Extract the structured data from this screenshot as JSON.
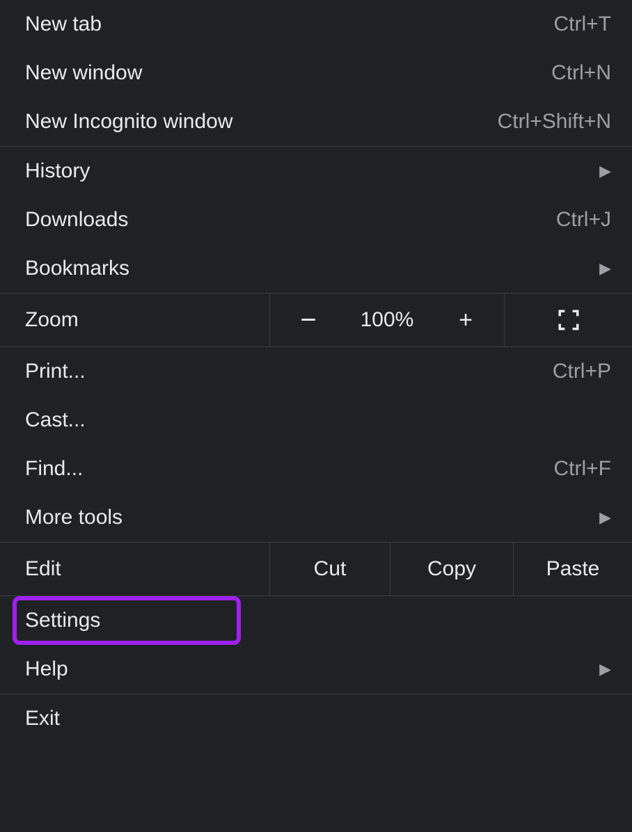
{
  "section1": {
    "new_tab": {
      "label": "New tab",
      "shortcut": "Ctrl+T"
    },
    "new_window": {
      "label": "New window",
      "shortcut": "Ctrl+N"
    },
    "new_incognito": {
      "label": "New Incognito window",
      "shortcut": "Ctrl+Shift+N"
    }
  },
  "section2": {
    "history": {
      "label": "History"
    },
    "downloads": {
      "label": "Downloads",
      "shortcut": "Ctrl+J"
    },
    "bookmarks": {
      "label": "Bookmarks"
    }
  },
  "zoom": {
    "label": "Zoom",
    "minus": "−",
    "value": "100%",
    "plus": "+"
  },
  "section3": {
    "print": {
      "label": "Print...",
      "shortcut": "Ctrl+P"
    },
    "cast": {
      "label": "Cast..."
    },
    "find": {
      "label": "Find...",
      "shortcut": "Ctrl+F"
    },
    "more_tools": {
      "label": "More tools"
    }
  },
  "edit": {
    "label": "Edit",
    "cut": "Cut",
    "copy": "Copy",
    "paste": "Paste"
  },
  "section4": {
    "settings": {
      "label": "Settings"
    },
    "help": {
      "label": "Help"
    }
  },
  "section5": {
    "exit": {
      "label": "Exit"
    }
  },
  "highlight_color": "#a020f0"
}
